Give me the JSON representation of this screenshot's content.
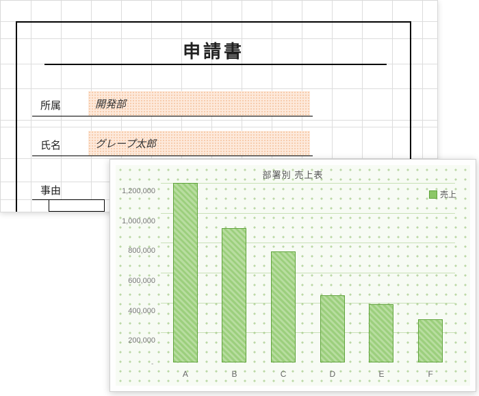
{
  "form": {
    "title": "申請書",
    "fields": {
      "dept_label": "所属",
      "dept_value": "開発部",
      "name_label": "氏名",
      "name_value": "グレープ太郎",
      "reason_label": "事由"
    }
  },
  "chart_data": {
    "type": "bar",
    "title": "部署別 売上表",
    "legend": "売上",
    "categories": [
      "A",
      "B",
      "C",
      "D",
      "E",
      "F"
    ],
    "values": [
      1200000,
      900000,
      740000,
      450000,
      390000,
      290000
    ],
    "ylim": [
      0,
      1200000
    ],
    "yticks": [
      "1,200,000",
      "1,000,000",
      "800,000",
      "600,000",
      "400,000",
      "200,000"
    ],
    "ylabel": "",
    "xlabel": ""
  },
  "colors": {
    "bar": "#8cc768",
    "bar_border": "#5fa33b",
    "field_bg": "#fde9db"
  }
}
